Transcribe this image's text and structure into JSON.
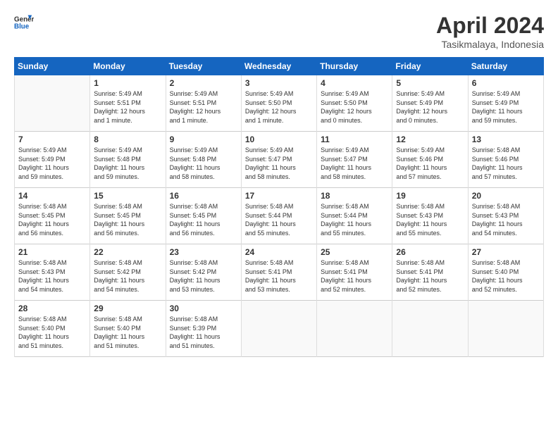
{
  "header": {
    "logo_general": "General",
    "logo_blue": "Blue",
    "title": "April 2024",
    "subtitle": "Tasikmalaya, Indonesia"
  },
  "days_of_week": [
    "Sunday",
    "Monday",
    "Tuesday",
    "Wednesday",
    "Thursday",
    "Friday",
    "Saturday"
  ],
  "weeks": [
    [
      {
        "day": "",
        "info": ""
      },
      {
        "day": "1",
        "info": "Sunrise: 5:49 AM\nSunset: 5:51 PM\nDaylight: 12 hours\nand 1 minute."
      },
      {
        "day": "2",
        "info": "Sunrise: 5:49 AM\nSunset: 5:51 PM\nDaylight: 12 hours\nand 1 minute."
      },
      {
        "day": "3",
        "info": "Sunrise: 5:49 AM\nSunset: 5:50 PM\nDaylight: 12 hours\nand 1 minute."
      },
      {
        "day": "4",
        "info": "Sunrise: 5:49 AM\nSunset: 5:50 PM\nDaylight: 12 hours\nand 0 minutes."
      },
      {
        "day": "5",
        "info": "Sunrise: 5:49 AM\nSunset: 5:49 PM\nDaylight: 12 hours\nand 0 minutes."
      },
      {
        "day": "6",
        "info": "Sunrise: 5:49 AM\nSunset: 5:49 PM\nDaylight: 11 hours\nand 59 minutes."
      }
    ],
    [
      {
        "day": "7",
        "info": "Sunrise: 5:49 AM\nSunset: 5:49 PM\nDaylight: 11 hours\nand 59 minutes."
      },
      {
        "day": "8",
        "info": "Sunrise: 5:49 AM\nSunset: 5:48 PM\nDaylight: 11 hours\nand 59 minutes."
      },
      {
        "day": "9",
        "info": "Sunrise: 5:49 AM\nSunset: 5:48 PM\nDaylight: 11 hours\nand 58 minutes."
      },
      {
        "day": "10",
        "info": "Sunrise: 5:49 AM\nSunset: 5:47 PM\nDaylight: 11 hours\nand 58 minutes."
      },
      {
        "day": "11",
        "info": "Sunrise: 5:49 AM\nSunset: 5:47 PM\nDaylight: 11 hours\nand 58 minutes."
      },
      {
        "day": "12",
        "info": "Sunrise: 5:49 AM\nSunset: 5:46 PM\nDaylight: 11 hours\nand 57 minutes."
      },
      {
        "day": "13",
        "info": "Sunrise: 5:48 AM\nSunset: 5:46 PM\nDaylight: 11 hours\nand 57 minutes."
      }
    ],
    [
      {
        "day": "14",
        "info": "Sunrise: 5:48 AM\nSunset: 5:45 PM\nDaylight: 11 hours\nand 56 minutes."
      },
      {
        "day": "15",
        "info": "Sunrise: 5:48 AM\nSunset: 5:45 PM\nDaylight: 11 hours\nand 56 minutes."
      },
      {
        "day": "16",
        "info": "Sunrise: 5:48 AM\nSunset: 5:45 PM\nDaylight: 11 hours\nand 56 minutes."
      },
      {
        "day": "17",
        "info": "Sunrise: 5:48 AM\nSunset: 5:44 PM\nDaylight: 11 hours\nand 55 minutes."
      },
      {
        "day": "18",
        "info": "Sunrise: 5:48 AM\nSunset: 5:44 PM\nDaylight: 11 hours\nand 55 minutes."
      },
      {
        "day": "19",
        "info": "Sunrise: 5:48 AM\nSunset: 5:43 PM\nDaylight: 11 hours\nand 55 minutes."
      },
      {
        "day": "20",
        "info": "Sunrise: 5:48 AM\nSunset: 5:43 PM\nDaylight: 11 hours\nand 54 minutes."
      }
    ],
    [
      {
        "day": "21",
        "info": "Sunrise: 5:48 AM\nSunset: 5:43 PM\nDaylight: 11 hours\nand 54 minutes."
      },
      {
        "day": "22",
        "info": "Sunrise: 5:48 AM\nSunset: 5:42 PM\nDaylight: 11 hours\nand 54 minutes."
      },
      {
        "day": "23",
        "info": "Sunrise: 5:48 AM\nSunset: 5:42 PM\nDaylight: 11 hours\nand 53 minutes."
      },
      {
        "day": "24",
        "info": "Sunrise: 5:48 AM\nSunset: 5:41 PM\nDaylight: 11 hours\nand 53 minutes."
      },
      {
        "day": "25",
        "info": "Sunrise: 5:48 AM\nSunset: 5:41 PM\nDaylight: 11 hours\nand 52 minutes."
      },
      {
        "day": "26",
        "info": "Sunrise: 5:48 AM\nSunset: 5:41 PM\nDaylight: 11 hours\nand 52 minutes."
      },
      {
        "day": "27",
        "info": "Sunrise: 5:48 AM\nSunset: 5:40 PM\nDaylight: 11 hours\nand 52 minutes."
      }
    ],
    [
      {
        "day": "28",
        "info": "Sunrise: 5:48 AM\nSunset: 5:40 PM\nDaylight: 11 hours\nand 51 minutes."
      },
      {
        "day": "29",
        "info": "Sunrise: 5:48 AM\nSunset: 5:40 PM\nDaylight: 11 hours\nand 51 minutes."
      },
      {
        "day": "30",
        "info": "Sunrise: 5:48 AM\nSunset: 5:39 PM\nDaylight: 11 hours\nand 51 minutes."
      },
      {
        "day": "",
        "info": ""
      },
      {
        "day": "",
        "info": ""
      },
      {
        "day": "",
        "info": ""
      },
      {
        "day": "",
        "info": ""
      }
    ]
  ]
}
